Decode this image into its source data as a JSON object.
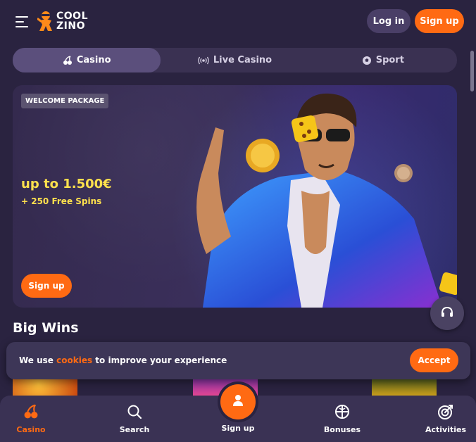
{
  "brand": {
    "line1": "COOL",
    "line2": "ZINO",
    "accent": "#ff6a13"
  },
  "header": {
    "login_label": "Log in",
    "signup_label": "Sign up"
  },
  "tabs": [
    {
      "label": "Casino",
      "icon": "cherries-icon",
      "active": true
    },
    {
      "label": "Live Casino",
      "icon": "broadcast-icon",
      "active": false
    },
    {
      "label": "Sport",
      "icon": "soccer-ball-icon",
      "active": false
    }
  ],
  "banner": {
    "badge": "WELCOME PACKAGE",
    "headline": "up to 1.500€",
    "subline": "+ 250 Free Spins",
    "cta": "Sign up"
  },
  "big_wins": {
    "title": "Big Wins"
  },
  "cookie": {
    "text_before": "We use ",
    "link": "cookies",
    "text_after": " to improve your experience",
    "accept_label": "Accept"
  },
  "bottom_nav": [
    {
      "label": "Casino",
      "icon": "cherries-icon",
      "active": true
    },
    {
      "label": "Search",
      "icon": "search-icon",
      "active": false
    },
    {
      "label": "Sign up",
      "icon": "user-icon",
      "active": false
    },
    {
      "label": "Bonuses",
      "icon": "gift-icon",
      "active": false
    },
    {
      "label": "Activities",
      "icon": "target-icon",
      "active": false
    }
  ]
}
